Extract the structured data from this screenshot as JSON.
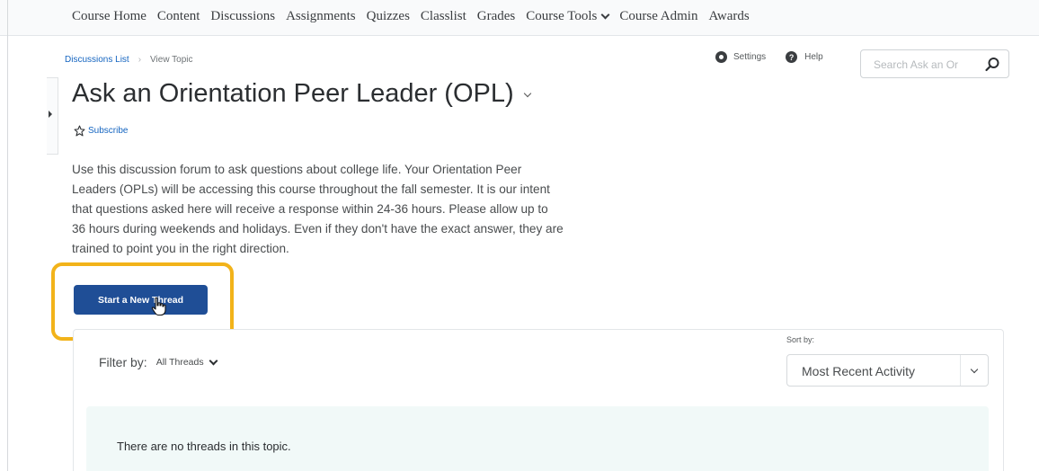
{
  "nav": {
    "items": [
      "Course Home",
      "Content",
      "Discussions",
      "Assignments",
      "Quizzes",
      "Classlist",
      "Grades",
      "Course Tools",
      "Course Admin",
      "Awards"
    ]
  },
  "breadcrumb": {
    "parent": "Discussions List",
    "current": "View Topic"
  },
  "tools": {
    "settings": "Settings",
    "help": "Help"
  },
  "search": {
    "placeholder": "Search Ask an Or"
  },
  "topic": {
    "title": "Ask an Orientation Peer Leader (OPL)",
    "subscribe": "Subscribe",
    "description_lines": [
      "Use this discussion forum to ask questions about college life. Your Orientation Peer",
      "Leaders (OPLs) will be accessing this course throughout the fall semester. It is our intent",
      "that questions asked here will receive a response within 24-36 hours. Please allow up to",
      "36 hours during weekends and holidays. Even if they don't have the exact answer, they are",
      "trained to point you in the right direction."
    ]
  },
  "actions": {
    "start_thread": "Start a New Thread"
  },
  "filter": {
    "label": "Filter by:",
    "value": "All Threads"
  },
  "sort": {
    "label": "Sort by:",
    "value": "Most Recent Activity"
  },
  "threads": {
    "empty_message": "There are no threads in this topic."
  },
  "colors": {
    "primary_button": "#1f4e96",
    "highlight": "#f2b31a",
    "link": "#1565c0",
    "empty_bg": "#f1f9f8"
  }
}
